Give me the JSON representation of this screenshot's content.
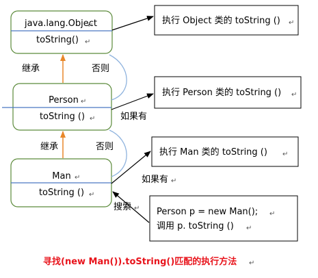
{
  "classes": {
    "object": {
      "name": "java.lang.Object",
      "method": "toString()"
    },
    "person": {
      "name": "Person",
      "method": "toString ()"
    },
    "man": {
      "name": "Man",
      "method": "toString ()"
    }
  },
  "notes": {
    "object": "执行 Object 类的 toString ()",
    "person": "执行 Person 类的 toString ()",
    "man": "执行 Man 类的 toString ()",
    "code_line1": "Person p = new Man();",
    "code_line2": "调用 p. toString ()"
  },
  "labels": {
    "inherit_person_object": "继承",
    "otherwise_person_object": "否则",
    "inherit_man_person": "继承",
    "otherwise_man_person": "否则",
    "if_has_person": "如果有",
    "if_has_man": "如果有",
    "search": "搜索"
  },
  "caption": "寻找(new Man()).toString()匹配的执行方法",
  "colors": {
    "box_border": "#5b8a3a",
    "divider": "#4a78c2",
    "inherit_arrow": "#e8872a",
    "curve": "#8fb3de",
    "caption": "#e8141c"
  }
}
